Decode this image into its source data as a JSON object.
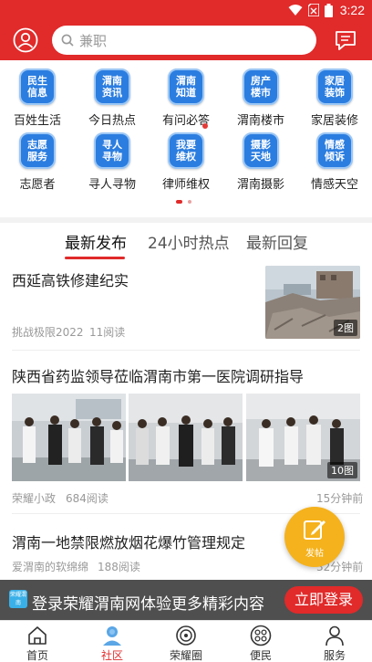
{
  "status_bar": {
    "time": "3:22"
  },
  "header": {
    "search_placeholder": "兼职",
    "avatar_icon": "user-icon",
    "message_icon": "chat-icon"
  },
  "colors": {
    "brand_red": "#e12a2a",
    "badge_blue": "#2b7de0",
    "fab_yellow": "#f5b21c"
  },
  "grid": {
    "items": [
      {
        "badge": "民生\n信息",
        "label": "百姓生活"
      },
      {
        "badge": "渭南\n资讯",
        "label": "今日热点"
      },
      {
        "badge": "渭南\n知道",
        "label": "有问必答"
      },
      {
        "badge": "房产\n楼市",
        "label": "渭南楼市"
      },
      {
        "badge": "家居\n装饰",
        "label": "家居装修"
      },
      {
        "badge": "志愿\n服务",
        "label": "志愿者"
      },
      {
        "badge": "寻人\n寻物",
        "label": "寻人寻物"
      },
      {
        "badge": "我要\n维权",
        "label": "律师维权"
      },
      {
        "badge": "摄影\n天地",
        "label": "渭南摄影"
      },
      {
        "badge": "情感\n倾诉",
        "label": "情感天空"
      }
    ]
  },
  "tabs": [
    "最新发布",
    "24小时热点",
    "最新回复"
  ],
  "feed": {
    "posts": [
      {
        "title": "西延高铁修建纪实",
        "author": "挑战极限2022",
        "reads": "11阅读",
        "image_count": "2图"
      },
      {
        "title": "陕西省药监领导莅临渭南市第一医院调研指导",
        "author": "荣耀小政",
        "reads": "684阅读",
        "time": "15分钟前",
        "image_count": "10图"
      },
      {
        "title": "渭南一地禁限燃放烟花爆竹管理规定",
        "author": "爱渭南的软绵绵",
        "reads": "188阅读",
        "time": "32分钟前"
      }
    ]
  },
  "fab": {
    "label": "发帖",
    "icon": "edit-icon"
  },
  "login_banner": {
    "logo_text": "荣耀渭南",
    "text": "登录荣耀渭南网体验更多精彩内容",
    "button": "立即登录"
  },
  "bottom_nav": [
    {
      "label": "首页",
      "icon": "home-icon"
    },
    {
      "label": "社区",
      "icon": "community-icon",
      "active": true
    },
    {
      "label": "荣耀圈",
      "icon": "circle-icon"
    },
    {
      "label": "便民",
      "icon": "services-icon"
    },
    {
      "label": "服务",
      "icon": "person-icon"
    }
  ]
}
